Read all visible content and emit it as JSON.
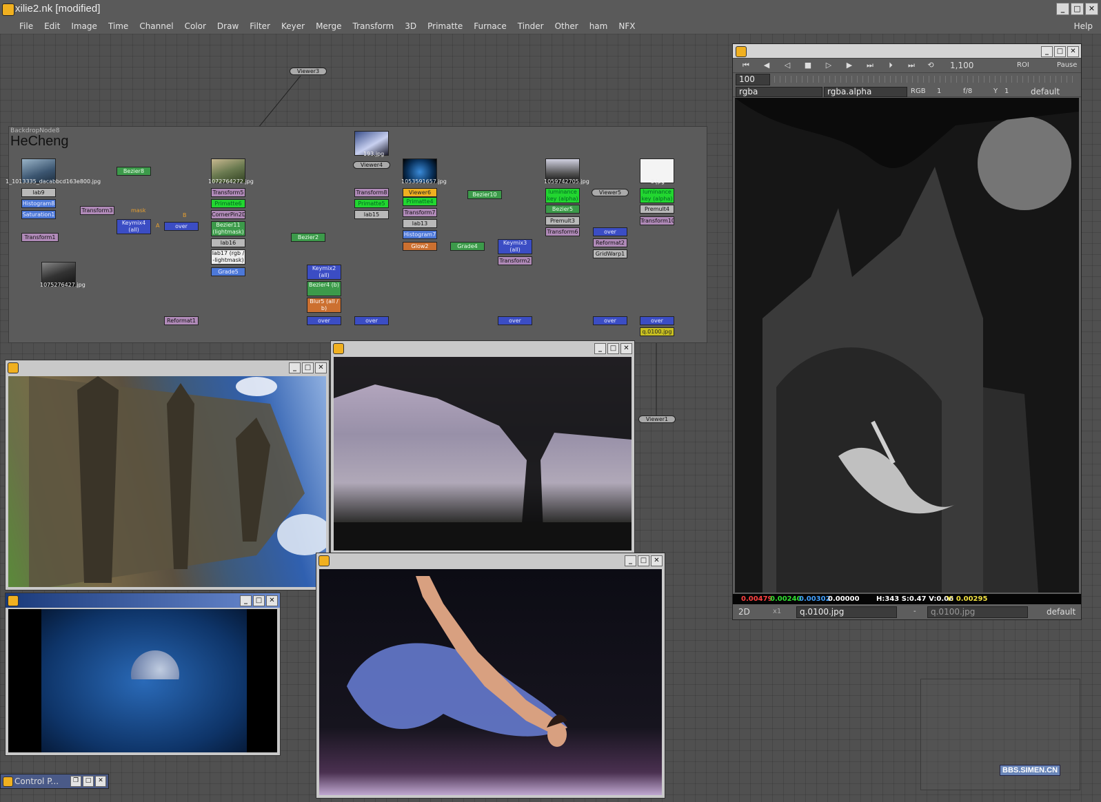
{
  "app": {
    "title": "xilie2.nk [modified]",
    "window_controls": [
      "_",
      "□",
      "✕"
    ]
  },
  "menu": {
    "items": [
      "File",
      "Edit",
      "Image",
      "Time",
      "Channel",
      "Color",
      "Draw",
      "Filter",
      "Keyer",
      "Merge",
      "Transform",
      "3D",
      "Primatte",
      "Furnace",
      "Tinder",
      "Other",
      "ham",
      "NFX"
    ],
    "help": "Help"
  },
  "backdrop": {
    "name": "BackdropNode8",
    "label": "HeCheng"
  },
  "nodes": {
    "viewer3": "Viewer3",
    "viewer4": "Viewer4",
    "viewer5": "Viewer5",
    "viewer1": "Viewer1",
    "read1": "1_1013335_dacabbcd163e800.jpg",
    "read2": "1072764272.jpg",
    "read3": "193.jpg",
    "read4": "1053591657.jpg",
    "read5": "1059742705.jpg",
    "read6": "3.jpg",
    "read7": "1075276427.jpg",
    "lab9": "lab9",
    "histogram8": "Histogram8",
    "saturation1": "Saturation1",
    "transform1": "Transform1",
    "transform3": "Transform3",
    "bezier8": "Bezier8",
    "keymix4": "Keymix4 (all)",
    "over1": "over",
    "transform5": "Transform5",
    "primatte6": "Primatte6",
    "cornerpin": "CornerPin2D2",
    "bezier11": "Bezier11 (lightmask)",
    "lab16": "lab16",
    "lab17": "lab17 (rgb / -lightmask)",
    "grade5": "Grade5",
    "bezier2": "Bezier2",
    "keymix2": "Keymix2 (all)",
    "bezier4": "Bezier4 (b)",
    "blur5": "Blur5 (all / b)",
    "over2": "over",
    "transform8": "Transform8",
    "primatte5": "Primatte5",
    "lab15": "lab15",
    "over3": "over",
    "viewer6": "Viewer6",
    "primatte4": "Primatte4",
    "transform7": "Transform7",
    "lab13": "lab13",
    "histogram7": "Histogram7",
    "glow2": "Glow2",
    "bezier10": "Bezier10",
    "grade4": "Grade4",
    "keymix3": "Keymix3 (all)",
    "transform2": "Transform2",
    "over4": "over",
    "lumkey1": "luminance key (alpha)",
    "bezier5": "Bezier5",
    "premult3": "Premult3",
    "transform6": "Transform6",
    "over5": "over",
    "reformat2": "Reformat2",
    "gridwarp1": "GridWarp1",
    "over6": "over",
    "lumkey2": "luminance key (alpha)",
    "premult4": "Premult4",
    "transform10": "Transform10",
    "over7": "over",
    "write": "q.0100.jpg",
    "reformat1": "Reformat1",
    "mask_label": "mask",
    "input_a": "A",
    "input_b": "B"
  },
  "floating_windows": {
    "cathedral": {
      "title": ""
    },
    "tree": {
      "title": ""
    },
    "moon": {
      "title": ""
    },
    "dancer": {
      "title": ""
    }
  },
  "viewer": {
    "frame_range": "1,100",
    "frame": "100",
    "roi": "ROI",
    "pause": "Pause",
    "channels": "rgba",
    "alpha_channel": "rgba.alpha",
    "rgb_mode": "RGB",
    "gain": "1",
    "fstop": "f/8",
    "y_label": "Y",
    "gamma": "1",
    "lut": "default",
    "status": {
      "r": "0.00479",
      "g": "0.00240",
      "b": "0.00302",
      "a": "0.00000",
      "hsv": "H:343 S:0.47 V:0.06",
      "y": "Y: 0.00295"
    },
    "view_mode": "2D",
    "zoom": "x1",
    "input_a": "q.0100.jpg",
    "compare": "-",
    "input_b": "q.0100.jpg",
    "display": "default"
  },
  "control_panel": {
    "title": "Control P..."
  },
  "watermark": "BBS.SIMEN.CN",
  "colors": {
    "accent": "#f0b020",
    "status_r": "#ff4040",
    "status_g": "#30e030",
    "status_b": "#40a0ff"
  }
}
